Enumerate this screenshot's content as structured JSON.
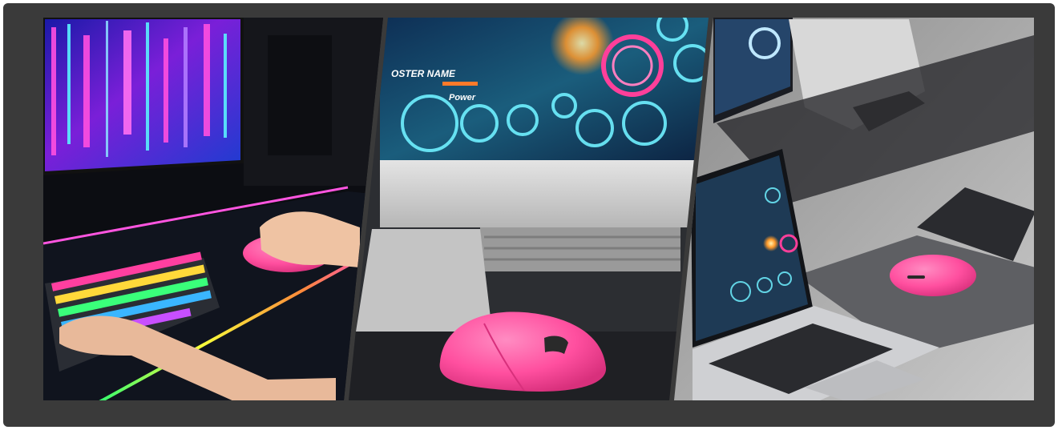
{
  "image": {
    "description_text": {
      "monitor_name_label": "OSTER NAME",
      "power_label": "Power"
    }
  },
  "colors": {
    "frame": "#3a3a3a",
    "pink_mouse": "#ff5aa6",
    "neon_pink": "#ff3f9a",
    "neon_cyan": "#6ff0ff",
    "neon_blue": "#3a6bff"
  }
}
